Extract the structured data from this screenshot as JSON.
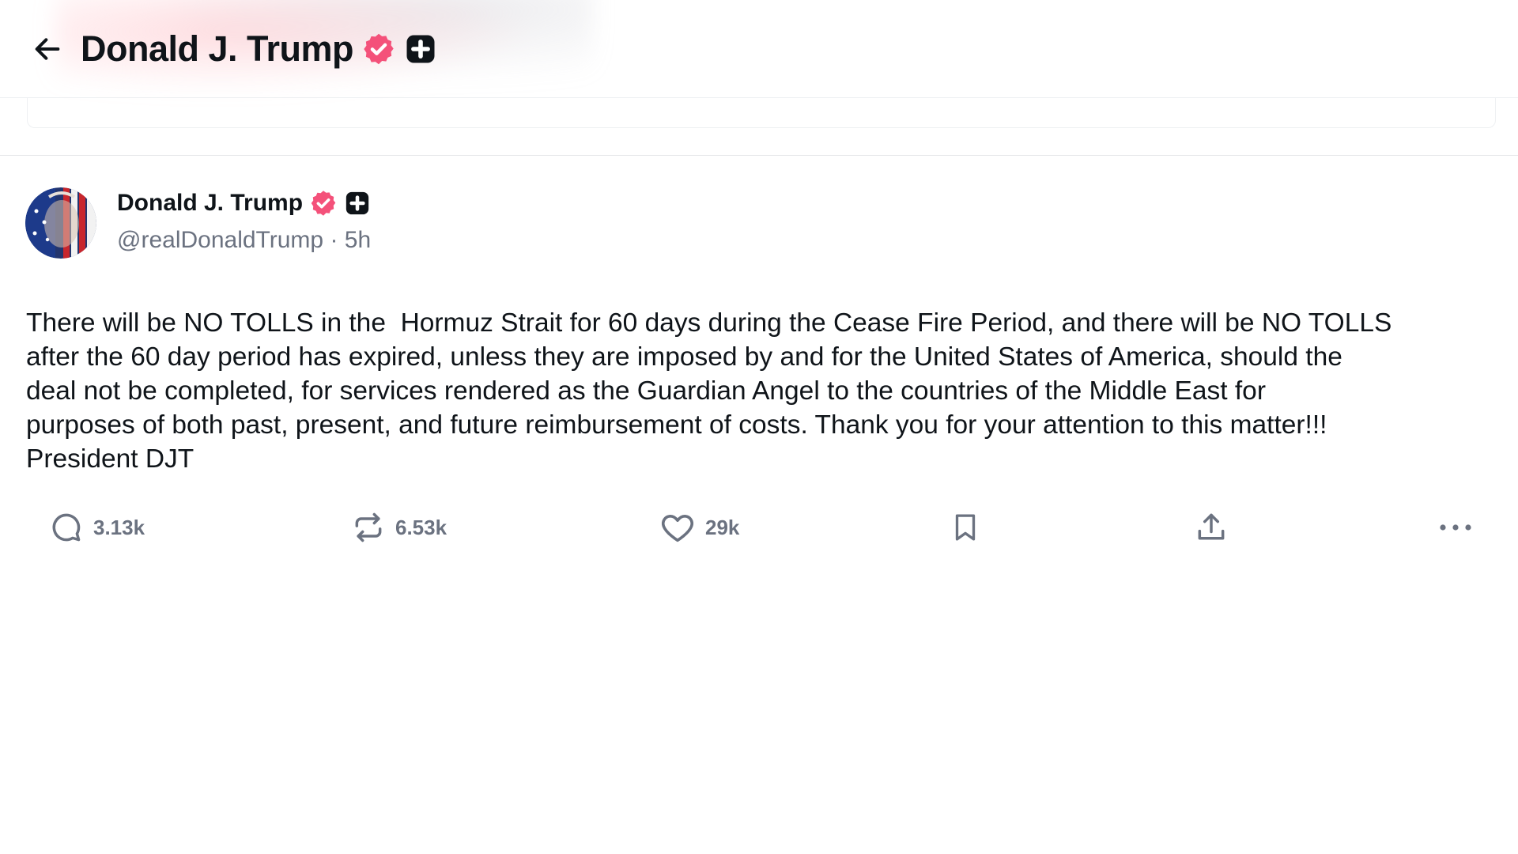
{
  "header": {
    "title": "Donald J. Trump"
  },
  "post": {
    "author_name": "Donald J. Trump",
    "handle_time": "@realDonaldTrump · 5h",
    "text": "There will be NO TOLLS in the  Hormuz Strait for 60 days during the Cease Fire Period, and there will be NO TOLLS\nafter the 60 day period has expired, unless they are imposed by and for the United States of America, should the\ndeal not be completed, for services rendered as the Guardian Angel to the countries of the Middle East for\npurposes of both past, present, and future reimbursement of costs. Thank you for your attention to this matter!!!\nPresident DJT",
    "replies": "3.13k",
    "reposts": "6.53k",
    "likes": "29k"
  },
  "icons": {
    "back": "arrow-left-icon",
    "verified": "verified-badge-icon",
    "plus": "plus-badge-icon",
    "reply": "reply-icon",
    "repost": "repost-icon",
    "like": "heart-icon",
    "bookmark": "bookmark-icon",
    "share": "share-icon",
    "more": "more-icon"
  },
  "colors": {
    "verified": "#f4517a",
    "text": "#0f1419",
    "muted": "#6b7280"
  }
}
